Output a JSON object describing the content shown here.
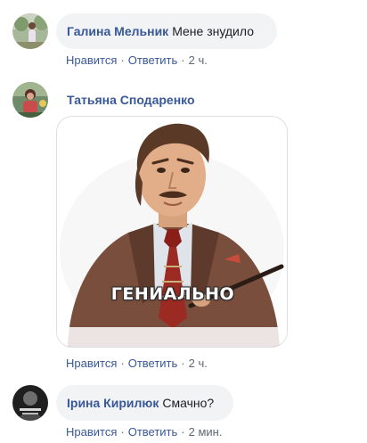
{
  "colors": {
    "author_link": "#385898",
    "action_link": "#385898",
    "meta_text": "#606770",
    "bubble_bg": "#f2f3f5"
  },
  "comments": [
    {
      "author": "Галина Мельник",
      "text": "Мене знудило",
      "like_label": "Нравится",
      "reply_label": "Ответить",
      "time": "2 ч.",
      "avatar_icon": "user-avatar"
    },
    {
      "author": "Татьяна Сподаренко",
      "sticker_caption": "ГЕНИАЛЬНО",
      "sticker_icon": "man-in-suit-sticker",
      "like_label": "Нравится",
      "reply_label": "Ответить",
      "time": "2 ч.",
      "avatar_icon": "user-avatar"
    },
    {
      "author": "Ірина Кирилюк",
      "text": "Смачно?",
      "like_label": "Нравится",
      "reply_label": "Ответить",
      "time": "2 мин.",
      "avatar_icon": "user-avatar"
    }
  ],
  "separator": "·"
}
